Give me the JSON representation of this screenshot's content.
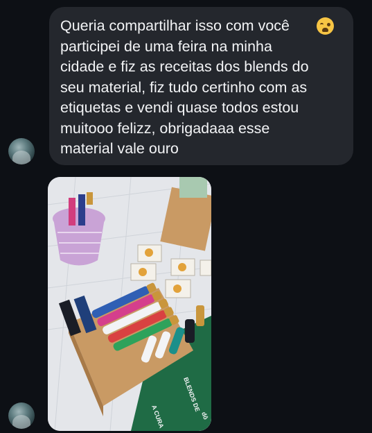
{
  "message": {
    "text": "Queria compartilhar isso com você\nparticipei de uma feira na minha\ncidade e fiz as receitas dos blends do\nseu material, fiz tudo certinho com as\netiquetas e vendi quase todos estou\nmuitooo felizz, obrigadaaa esse\nmaterial vale ouro",
    "emoji": "loudly-crying-face-icon"
  },
  "photo": {
    "banner_text_1": "BLENDS DE",
    "banner_text_2": "A CURA",
    "banner_text_3": "dô",
    "colors": {
      "tablecloth": "#e4e6ea",
      "basket": "#c9a3d6",
      "box": "#c99a64",
      "green_banner": "#1f6b45"
    }
  },
  "colors": {
    "background": "#0d1015",
    "bubble": "#24272d",
    "text": "#f3f4f6"
  }
}
